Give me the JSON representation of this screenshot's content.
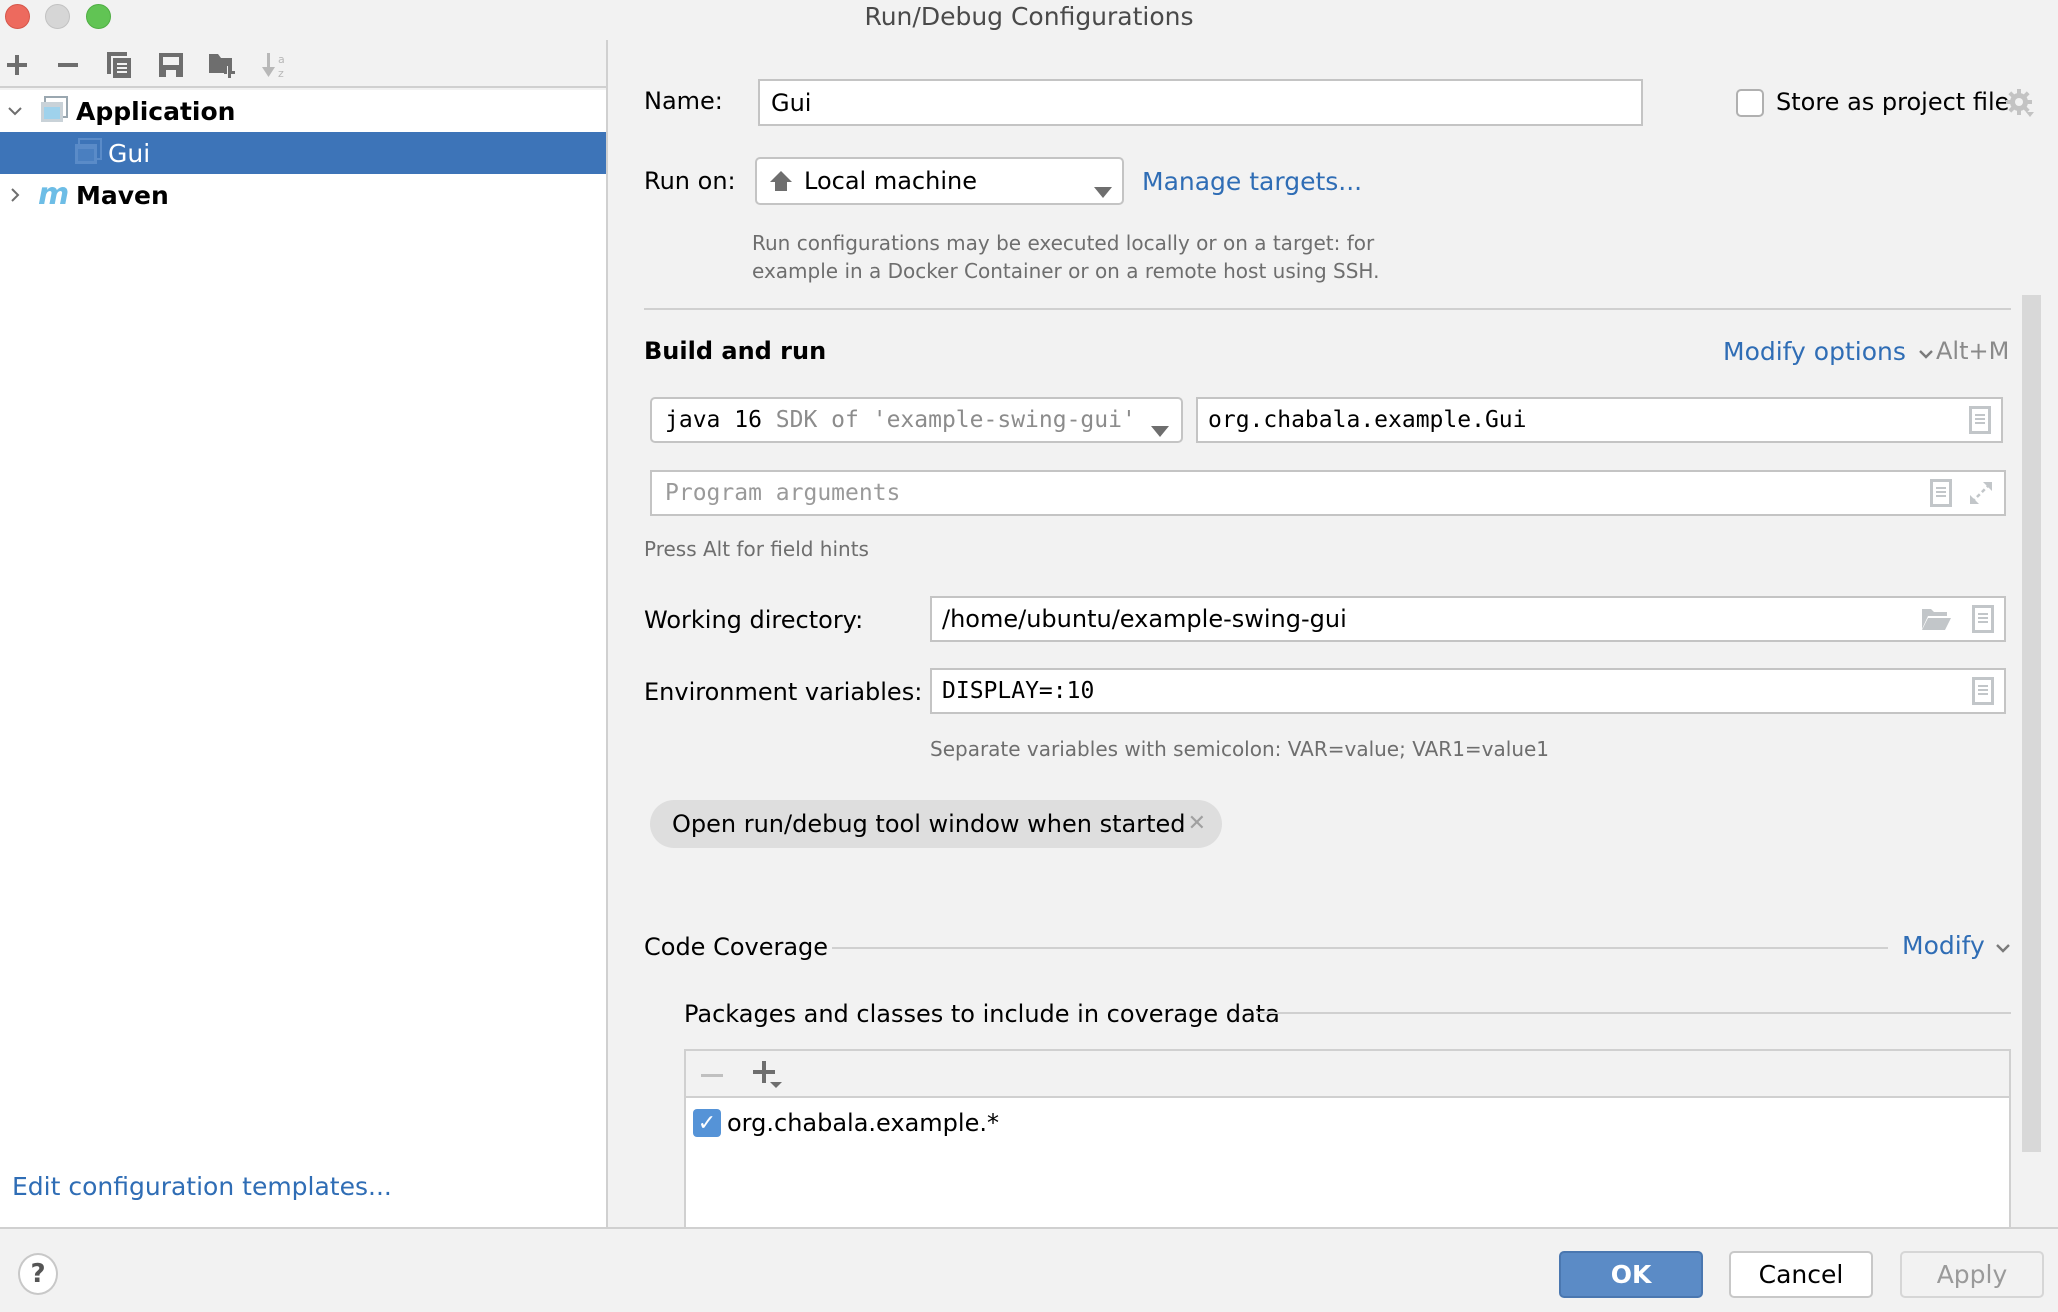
{
  "window": {
    "title": "Run/Debug Configurations",
    "controls": [
      "close",
      "minimize",
      "maximize"
    ]
  },
  "left_toolbar": {
    "icons": [
      "add-icon",
      "remove-icon",
      "copy-icon",
      "save-icon",
      "new-folder-icon",
      "sort-alpha-icon"
    ]
  },
  "tree": {
    "items": [
      {
        "label": "Application",
        "expanded": true,
        "bold": true,
        "icon": "application-icon"
      },
      {
        "label": "Gui",
        "selected": true,
        "icon": "application-config-icon"
      },
      {
        "label": "Maven",
        "expanded": false,
        "bold": true,
        "icon": "maven-icon"
      }
    ]
  },
  "edit_templates_link": "Edit configuration templates...",
  "form": {
    "name_label": "Name:",
    "name_value": "Gui",
    "store_as_project_file": {
      "label": "Store as project file",
      "checked": false
    },
    "run_on_label": "Run on:",
    "run_on_value": "Local machine",
    "manage_targets": "Manage targets...",
    "run_on_hint_line1": "Run configurations may be executed locally or on a target: for",
    "run_on_hint_line2": "example in a Docker Container or on a remote host using SSH.",
    "build_and_run": {
      "title": "Build and run",
      "modify_options": "Modify options",
      "modify_shortcut": "Alt+M",
      "jdk_primary": "java 16",
      "jdk_secondary": "SDK of 'example-swing-gui'",
      "main_class": "org.chabala.example.Gui",
      "program_args_placeholder": "Program arguments",
      "field_hint": "Press Alt for field hints"
    },
    "working_dir_label": "Working directory:",
    "working_dir_value": "/home/ubuntu/example-swing-gui",
    "env_label": "Environment variables:",
    "env_value": "DISPLAY=:10",
    "env_hint": "Separate variables with semicolon: VAR=value; VAR1=value1",
    "chip_label": "Open run/debug tool window when started",
    "code_coverage": {
      "title": "Code Coverage",
      "modify": "Modify",
      "packages_title": "Packages and classes to include in coverage data",
      "entries": [
        {
          "pattern": "org.chabala.example.*",
          "checked": true
        }
      ]
    }
  },
  "buttons": {
    "ok": "OK",
    "cancel": "Cancel",
    "apply": "Apply",
    "help": "?"
  },
  "colors": {
    "accent": "#3d74b8",
    "link": "#2f6db5",
    "ok_button": "#5b8bc6"
  }
}
